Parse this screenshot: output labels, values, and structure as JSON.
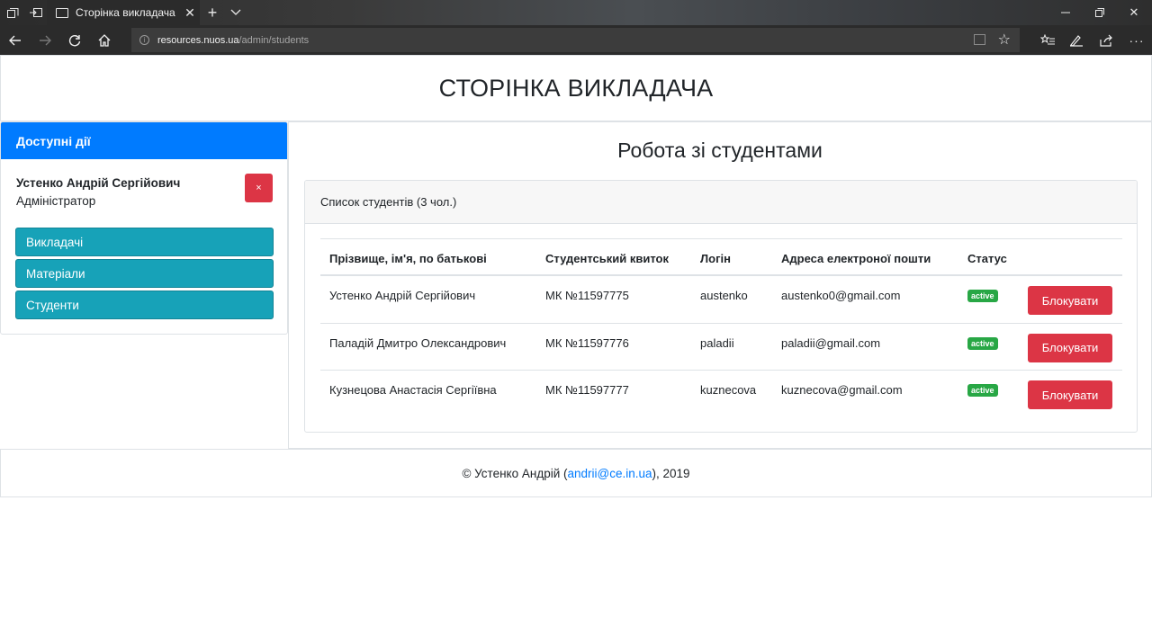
{
  "browser": {
    "tab_title": "Сторінка викладача",
    "url_host": "resources.nuos.ua",
    "url_path": "/admin/students"
  },
  "page": {
    "title": "СТОРІНКА ВИКЛАДАЧА"
  },
  "sidebar": {
    "header": "Доступні дії",
    "user_name": "Устенко Андрій Сергійович",
    "user_role": "Адміністратор",
    "logout_label": "×",
    "items": [
      {
        "label": "Викладачі"
      },
      {
        "label": "Матеріали"
      },
      {
        "label": "Студенти"
      }
    ]
  },
  "main": {
    "title": "Робота зі студентами",
    "card_header": "Список студентів (3 чол.)",
    "columns": [
      "Прізвище, ім'я, по батькові",
      "Студентський квиток",
      "Логін",
      "Адреса електроної пошти",
      "Статус"
    ],
    "rows": [
      {
        "name": "Устенко Андрій Сергійович",
        "ticket": "МК №11597775",
        "login": "austenko",
        "email": "austenko0@gmail.com",
        "status": "active",
        "action": "Блокувати"
      },
      {
        "name": "Паладій Дмитро Олександрович",
        "ticket": "МК №11597776",
        "login": "paladii",
        "email": "paladii@gmail.com",
        "status": "active",
        "action": "Блокувати"
      },
      {
        "name": "Кузнецова Анастасія Сергіївна",
        "ticket": "МК №11597777",
        "login": "kuznecova",
        "email": "kuznecova@gmail.com",
        "status": "active",
        "action": "Блокувати"
      }
    ]
  },
  "footer": {
    "prefix": "© Устенко Андрій (",
    "email": "andrii@ce.in.ua",
    "suffix": "), 2019"
  },
  "colors": {
    "primary": "#007bff",
    "info": "#17a2b8",
    "danger": "#dc3545",
    "success": "#28a745"
  },
  "icons": [
    "tab-actions-icon",
    "set-aside-tabs-icon",
    "page-icon",
    "close-icon",
    "new-tab-icon",
    "tab-preview-icon",
    "minimize-icon",
    "restore-icon",
    "window-close-icon",
    "back-icon",
    "forward-icon",
    "refresh-icon",
    "home-icon",
    "info-icon",
    "reading-view-icon",
    "favorite-star-icon",
    "favorites-icon",
    "notes-icon",
    "share-icon",
    "more-icon"
  ]
}
